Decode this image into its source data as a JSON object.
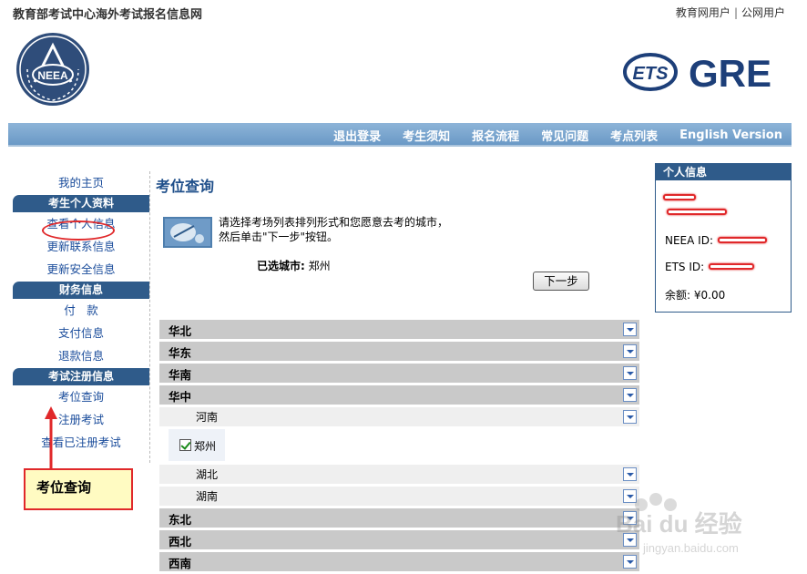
{
  "header": {
    "site_title": "教育部考试中心海外考试报名信息网",
    "link_edu": "教育网用户",
    "separator": "|",
    "link_public": "公网用户",
    "logo_text": "NEEA",
    "brand_ets": "ETS",
    "brand_gre": "GRE"
  },
  "nav": [
    {
      "label": "退出登录"
    },
    {
      "label": "考生须知"
    },
    {
      "label": "报名流程"
    },
    {
      "label": "常见问题"
    },
    {
      "label": "考点列表"
    },
    {
      "label": "English Version"
    }
  ],
  "sidebar": {
    "home": "我的主页",
    "section_profile": "考生个人资料",
    "view_profile": "查看个人信息",
    "update_contact": "更新联系信息",
    "update_security": "更新安全信息",
    "section_finance": "财务信息",
    "pay": "付　款",
    "payment_info": "支付信息",
    "refund_info": "退款信息",
    "section_exam": "考试注册信息",
    "seat_query": "考位查询",
    "register_exam": "注册考试",
    "view_registered": "查看已注册考试"
  },
  "annotation": {
    "callout": "考位查询"
  },
  "main": {
    "title": "考位查询",
    "instruction_line1": "请选择考场列表排列形式和您愿意去考的城市，",
    "instruction_line2": "然后单击\"下一步\"按钮。",
    "selected_label": "已选城市:",
    "selected_city": "郑州",
    "next_button": "下一步",
    "regions": [
      {
        "label": "华北"
      },
      {
        "label": "华东"
      },
      {
        "label": "华南"
      },
      {
        "label": "华中"
      }
    ],
    "subregion_henan": "河南",
    "city_zhengzhou": "郑州",
    "subregion_hubei": "湖北",
    "subregion_hunan": "湖南",
    "regions_after": [
      {
        "label": "东北"
      },
      {
        "label": "西北"
      },
      {
        "label": "西南"
      }
    ]
  },
  "personal_info": {
    "title": "个人信息",
    "neea_id_label": "NEEA ID:",
    "ets_id_label": "ETS ID:",
    "balance_label": "余额:",
    "balance_value": "¥0.00"
  },
  "watermark": {
    "text": "Bai du 经验",
    "url": "jingyan.baidu.com"
  },
  "colors": {
    "nav_blue": "#6a99c6",
    "header_blue": "#2f5b8a",
    "link_blue": "#1a4c9b",
    "annotation_red": "#e0282a"
  }
}
